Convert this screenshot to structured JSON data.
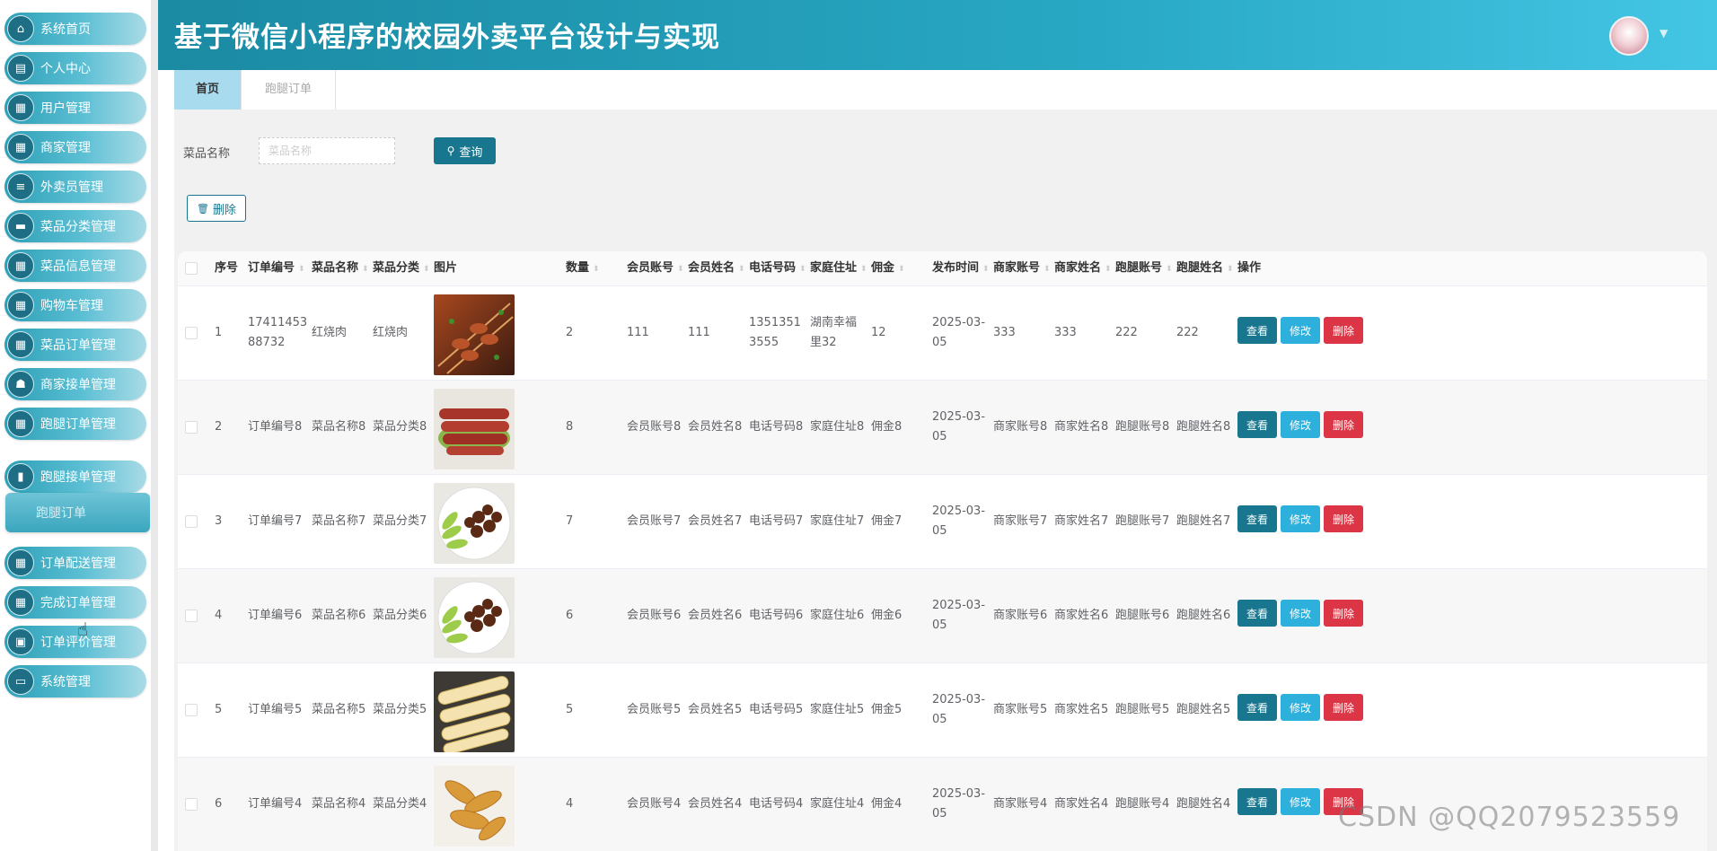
{
  "app": {
    "title": "基于微信小程序的校园外卖平台设计与实现"
  },
  "sidebar": {
    "items": [
      {
        "label": "系统首页",
        "icon": "home-icon",
        "glyph": "⌂"
      },
      {
        "label": "个人中心",
        "icon": "user-card-icon",
        "glyph": "▤"
      },
      {
        "label": "用户管理",
        "icon": "grid-icon",
        "glyph": "▦"
      },
      {
        "label": "商家管理",
        "icon": "grid-icon",
        "glyph": "▦"
      },
      {
        "label": "外卖员管理",
        "icon": "sliders-icon",
        "glyph": "≡"
      },
      {
        "label": "菜品分类管理",
        "icon": "chat-icon",
        "glyph": "▬"
      },
      {
        "label": "菜品信息管理",
        "icon": "grid-icon",
        "glyph": "▦"
      },
      {
        "label": "购物车管理",
        "icon": "grid-icon",
        "glyph": "▦"
      },
      {
        "label": "菜品订单管理",
        "icon": "grid-icon",
        "glyph": "▦"
      },
      {
        "label": "商家接单管理",
        "icon": "thumb-icon",
        "glyph": "☗"
      },
      {
        "label": "跑腿订单管理",
        "icon": "grid-icon",
        "glyph": "▦"
      },
      {
        "label": "跑腿接单管理",
        "icon": "book-icon",
        "glyph": "▮"
      },
      {
        "label": "订单配送管理",
        "icon": "grid-icon",
        "glyph": "▦"
      },
      {
        "label": "完成订单管理",
        "icon": "grid-icon",
        "glyph": "▦"
      },
      {
        "label": "订单评价管理",
        "icon": "clipboard-icon",
        "glyph": "▣"
      },
      {
        "label": "系统管理",
        "icon": "monitor-icon",
        "glyph": "▭"
      }
    ],
    "submenu_item": "跑腿订单"
  },
  "tabs": [
    {
      "label": "首页",
      "active": true
    },
    {
      "label": "跑腿订单",
      "active": false
    }
  ],
  "search": {
    "label": "菜品名称",
    "placeholder": "菜品名称",
    "value": "",
    "button": "查询",
    "button_icon": "search-icon"
  },
  "toolbar": {
    "delete_label": "删除",
    "delete_icon": "trash-icon"
  },
  "table": {
    "columns": [
      "序号",
      "订单编号",
      "菜品名称",
      "菜品分类",
      "图片",
      "数量",
      "会员账号",
      "会员姓名",
      "电话号码",
      "家庭住址",
      "佣金",
      "发布时间",
      "商家账号",
      "商家姓名",
      "跑腿账号",
      "跑腿姓名",
      "操作"
    ],
    "actions": {
      "view": "查看",
      "edit": "修改",
      "delete": "删除"
    },
    "rows": [
      {
        "index": "1",
        "order_no": "1741145388732",
        "dish_name": "红烧肉",
        "dish_category": "红烧肉",
        "image": "skewers",
        "quantity": "2",
        "member_account": "111",
        "member_name": "111",
        "phone": "13513513555",
        "address": "湖南幸福里32",
        "commission": "12",
        "publish_time": "2025-03-05",
        "merchant_account": "333",
        "merchant_name": "333",
        "runner_account": "222",
        "runner_name": "222"
      },
      {
        "index": "2",
        "order_no": "订单编号8",
        "dish_name": "菜品名称8",
        "dish_category": "菜品分类8",
        "image": "sausages",
        "quantity": "8",
        "member_account": "会员账号8",
        "member_name": "会员姓名8",
        "phone": "电话号码8",
        "address": "家庭住址8",
        "commission": "佣金8",
        "publish_time": "2025-03-05",
        "merchant_account": "商家账号8",
        "merchant_name": "商家姓名8",
        "runner_account": "跑腿账号8",
        "runner_name": "跑腿姓名8"
      },
      {
        "index": "3",
        "order_no": "订单编号7",
        "dish_name": "菜品名称7",
        "dish_category": "菜品分类7",
        "image": "braised-dish",
        "quantity": "7",
        "member_account": "会员账号7",
        "member_name": "会员姓名7",
        "phone": "电话号码7",
        "address": "家庭住址7",
        "commission": "佣金7",
        "publish_time": "2025-03-05",
        "merchant_account": "商家账号7",
        "merchant_name": "商家姓名7",
        "runner_account": "跑腿账号7",
        "runner_name": "跑腿姓名7"
      },
      {
        "index": "4",
        "order_no": "订单编号6",
        "dish_name": "菜品名称6",
        "dish_category": "菜品分类6",
        "image": "braised-dish",
        "quantity": "6",
        "member_account": "会员账号6",
        "member_name": "会员姓名6",
        "phone": "电话号码6",
        "address": "家庭住址6",
        "commission": "佣金6",
        "publish_time": "2025-03-05",
        "merchant_account": "商家账号6",
        "merchant_name": "商家姓名6",
        "runner_account": "跑腿账号6",
        "runner_name": "跑腿姓名6"
      },
      {
        "index": "5",
        "order_no": "订单编号5",
        "dish_name": "菜品名称5",
        "dish_category": "菜品分类5",
        "image": "rolls",
        "quantity": "5",
        "member_account": "会员账号5",
        "member_name": "会员姓名5",
        "phone": "电话号码5",
        "address": "家庭住址5",
        "commission": "佣金5",
        "publish_time": "2025-03-05",
        "merchant_account": "商家账号5",
        "merchant_name": "商家姓名5",
        "runner_account": "跑腿账号5",
        "runner_name": "跑腿姓名5"
      },
      {
        "index": "6",
        "order_no": "订单编号4",
        "dish_name": "菜品名称4",
        "dish_category": "菜品分类4",
        "image": "fried-food",
        "quantity": "4",
        "member_account": "会员账号4",
        "member_name": "会员姓名4",
        "phone": "电话号码4",
        "address": "家庭住址4",
        "commission": "佣金4",
        "publish_time": "2025-03-05",
        "merchant_account": "商家账号4",
        "merchant_name": "商家姓名4",
        "runner_account": "跑腿账号4",
        "runner_name": "跑腿姓名4"
      }
    ]
  },
  "watermark": "CSDN @QQ2079523559",
  "colors": {
    "header_start": "#1b8aa3",
    "header_end": "#43c6e4",
    "primary": "#18768e",
    "edit": "#2eb0dc",
    "danger": "#dc3545",
    "active_tab": "#a8dbee"
  }
}
